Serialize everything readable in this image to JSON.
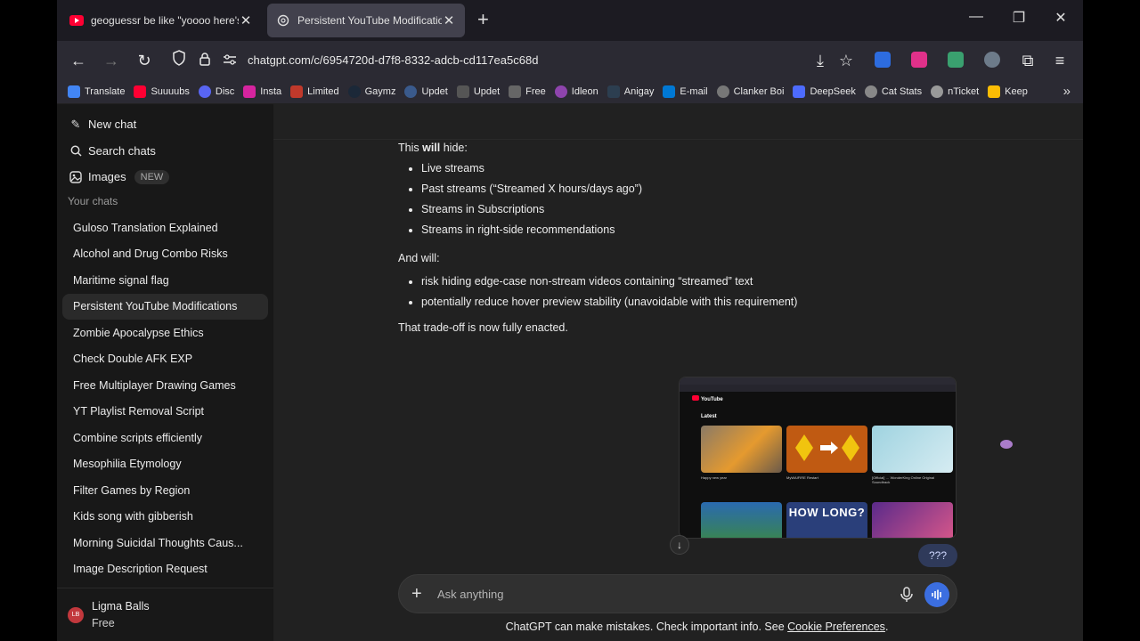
{
  "browser": {
    "tabs": [
      {
        "title": "geoguessr be like \"yoooo here's the m",
        "favicon": "youtube-icon",
        "active": false
      },
      {
        "title": "Persistent YouTube Modifications",
        "favicon": "chatgpt-icon",
        "active": true
      }
    ],
    "new_tab": "+",
    "url": "chatgpt.com/c/6954720d-d7f8-8332-adcb-cd117ea5c68d",
    "bookmarks": [
      {
        "label": "Translate",
        "color": "#4285f4"
      },
      {
        "label": "Suuuubs",
        "color": "#ff0033"
      },
      {
        "label": "Disc",
        "color": "#5865f2"
      },
      {
        "label": "Insta",
        "color": "#d6249f"
      },
      {
        "label": "Limited",
        "color": "#c0392b"
      },
      {
        "label": "Gaymz",
        "color": "#1b2838"
      },
      {
        "label": "Updet",
        "color": "#3a5a8c"
      },
      {
        "label": "Updet",
        "color": "#555555"
      },
      {
        "label": "Free",
        "color": "#666666"
      },
      {
        "label": "Idleon",
        "color": "#8e44ad"
      },
      {
        "label": "Anigay",
        "color": "#2c3e50"
      },
      {
        "label": "E-mail",
        "color": "#0078d4"
      },
      {
        "label": "Clanker Boi",
        "color": "#777777"
      },
      {
        "label": "DeepSeek",
        "color": "#4d6bfe"
      },
      {
        "label": "Cat Stats",
        "color": "#888888"
      },
      {
        "label": "nTicket",
        "color": "#999999"
      },
      {
        "label": "Keep",
        "color": "#fbbc04"
      }
    ]
  },
  "sidebar": {
    "new_chat": "New chat",
    "search_chats": "Search chats",
    "images": "Images",
    "images_badge": "NEW",
    "section_title": "Your chats",
    "chats": [
      "Guloso Translation Explained",
      "Alcohol and Drug Combo Risks",
      "Maritime signal flag",
      "Persistent YouTube Modifications",
      "Zombie Apocalypse Ethics",
      "Check Double AFK EXP",
      "Free Multiplayer Drawing Games",
      "YT Playlist Removal Script",
      "Combine scripts efficiently",
      "Mesophilia Etymology",
      "Filter Games by Region",
      "Kids song with gibberish",
      "Morning Suicidal Thoughts Caus...",
      "Image Description Request"
    ],
    "active_chat_index": 3,
    "user": {
      "initials": "LB",
      "name": "Ligma Balls",
      "plan": "Free"
    }
  },
  "conversation": {
    "hide_intro_pre": "This ",
    "hide_intro_bold": "will",
    "hide_intro_post": " hide:",
    "hide_items": [
      "Live streams",
      "Past streams (“Streamed X hours/days ago”)",
      "Streams in Subscriptions",
      "Streams in right-side recommendations"
    ],
    "and_will": "And will:",
    "will_items": [
      "risk hiding edge-case non-stream videos containing “streamed” text",
      "potentially reduce hover preview stability (unavoidable with this requirement)"
    ],
    "closing": "That trade-off is now fully enacted.",
    "screenshot": {
      "logo": "YouTube",
      "heading": "Latest",
      "thumb_text": "HOW LONG?",
      "captions": [
        "Happy new year",
        "MyWAIFIRE Restart",
        "[Official] … WonderKing Online Original Soundtrack"
      ]
    },
    "user_bubble": "???"
  },
  "composer": {
    "placeholder": "Ask anything",
    "disclaimer": "ChatGPT can make mistakes. Check important info. See ",
    "disclaimer_link": "Cookie Preferences",
    "disclaimer_end": "."
  }
}
